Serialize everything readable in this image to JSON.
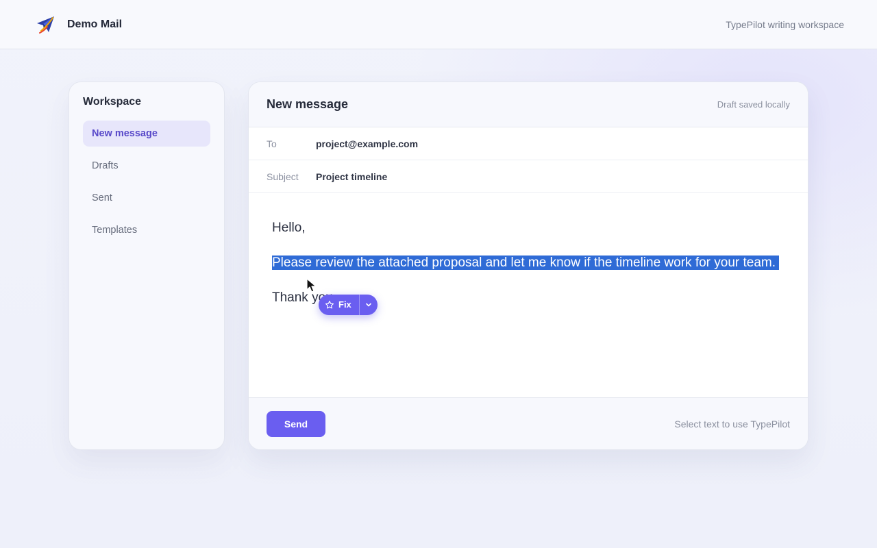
{
  "header": {
    "app_name": "Demo Mail",
    "tagline": "TypePilot writing workspace",
    "logo_icon": "paper-plane-logo-icon"
  },
  "sidebar": {
    "title": "Workspace",
    "items": [
      {
        "label": "New message",
        "active": true
      },
      {
        "label": "Drafts",
        "active": false
      },
      {
        "label": "Sent",
        "active": false
      },
      {
        "label": "Templates",
        "active": false
      }
    ]
  },
  "composer": {
    "title": "New message",
    "status": "Draft saved locally",
    "to_label": "To",
    "to_value": "project@example.com",
    "subject_label": "Subject",
    "subject_value": "Project timeline",
    "body": {
      "greeting": "Hello,",
      "selected_text": "Please review the attached proposal and let me know if the timeline work for your team.",
      "closing": "Thank you."
    },
    "fix_popup": {
      "label": "Fix",
      "icon": "star-icon",
      "dropdown_icon": "chevron-down-icon"
    },
    "send_label": "Send",
    "footer_hint": "Select text to use TypePilot"
  },
  "colors": {
    "accent": "#6a5ef0",
    "selection": "#2f6bd6",
    "active_nav_bg": "#e7e6fb",
    "active_nav_text": "#5849c9"
  }
}
